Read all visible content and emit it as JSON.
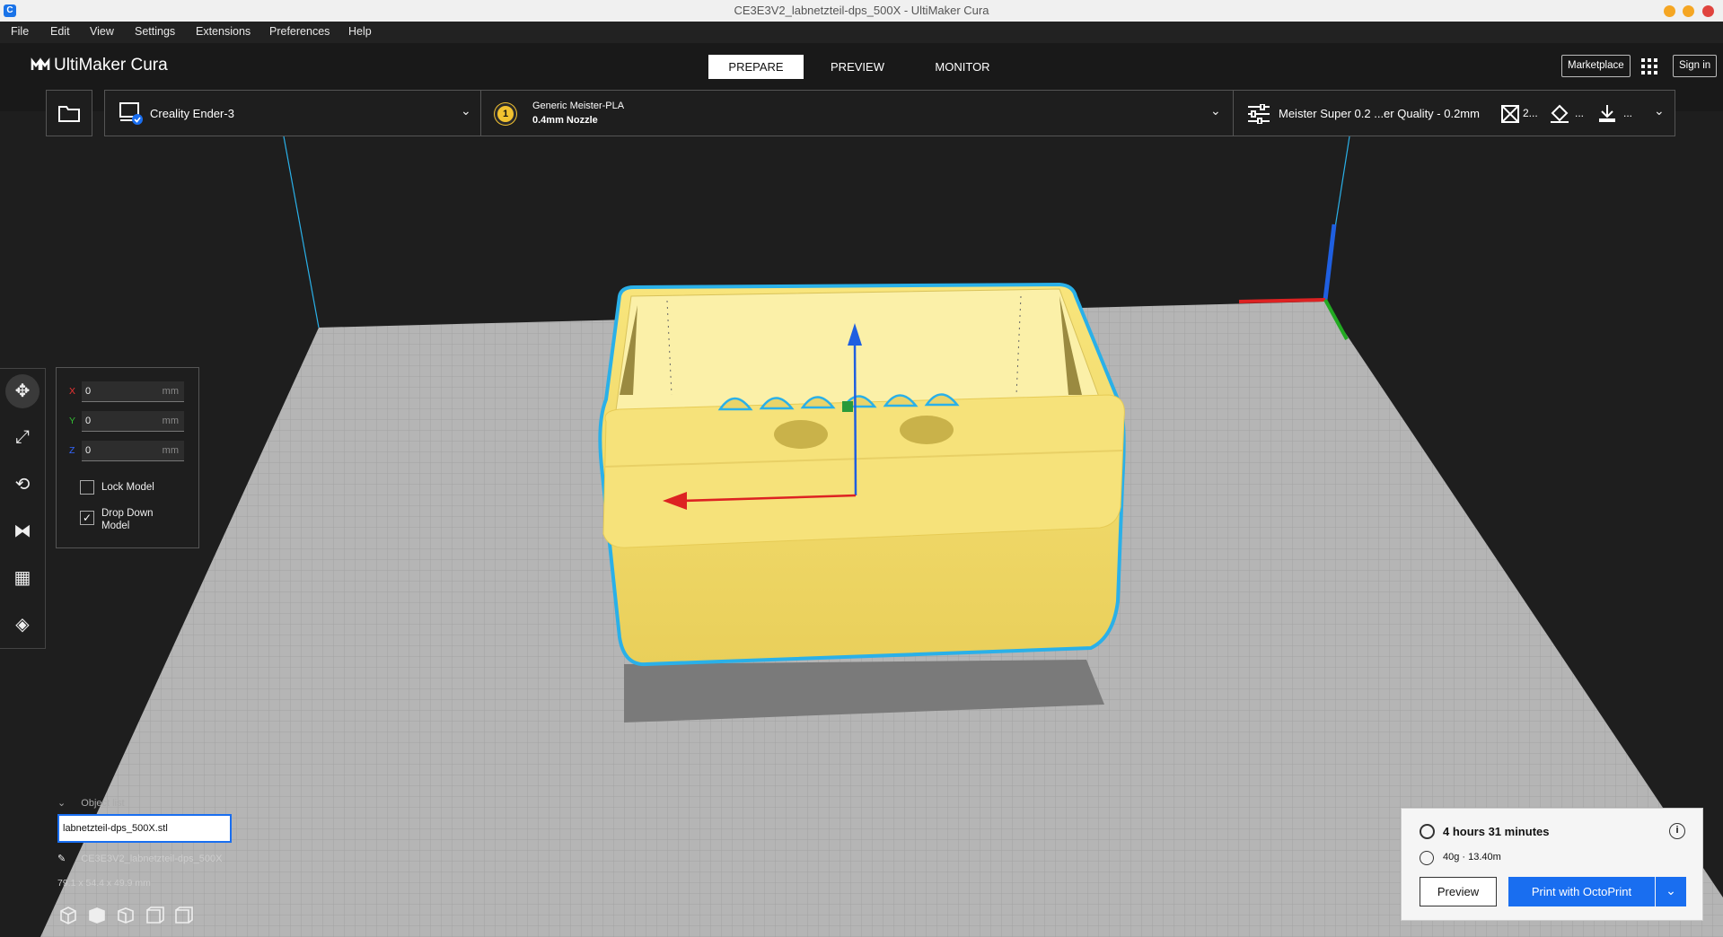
{
  "window": {
    "title": "CE3E3V2_labnetzteil-dps_500X - UltiMaker Cura",
    "app_icon": "C"
  },
  "menu": [
    "File",
    "Edit",
    "View",
    "Settings",
    "Extensions",
    "Preferences",
    "Help"
  ],
  "header": {
    "logo": "UltiMaker Cura",
    "stages": [
      "PREPARE",
      "PREVIEW",
      "MONITOR"
    ],
    "marketplace": "Marketplace",
    "signin": "Sign in"
  },
  "printer": {
    "name": "Creality Ender-3",
    "extruder_number": "1",
    "material": "Generic Meister-PLA",
    "nozzle": "0.4mm Nozzle",
    "profile": "Meister Super 0.2 ...er Quality - 0.2mm",
    "support": "2...",
    "adhesion": "...",
    "ellipsis": "..."
  },
  "move": {
    "x_label": "X",
    "y_label": "Y",
    "z_label": "Z",
    "x": "0",
    "y": "0",
    "z": "0",
    "unit": "mm",
    "lock_model": "Lock Model",
    "drop_down_model": "Drop Down Model",
    "lock_checked": false,
    "drop_checked": true
  },
  "object_list": {
    "header": "Object list",
    "selected_file": "labnetzteil-dps_500X.stl",
    "job_name": "CE3E3V2_labnetzteil-dps_500X",
    "dimensions": "79.1 x 54.4 x 49.9 mm"
  },
  "print": {
    "time": "4 hours 31 minutes",
    "material_use": "40g · 13.40m",
    "preview_button": "Preview",
    "print_button": "Print with OctoPrint"
  },
  "colors": {
    "accent": "#196ef0",
    "model": "#f6e27a",
    "outline": "#2ab0e8"
  }
}
